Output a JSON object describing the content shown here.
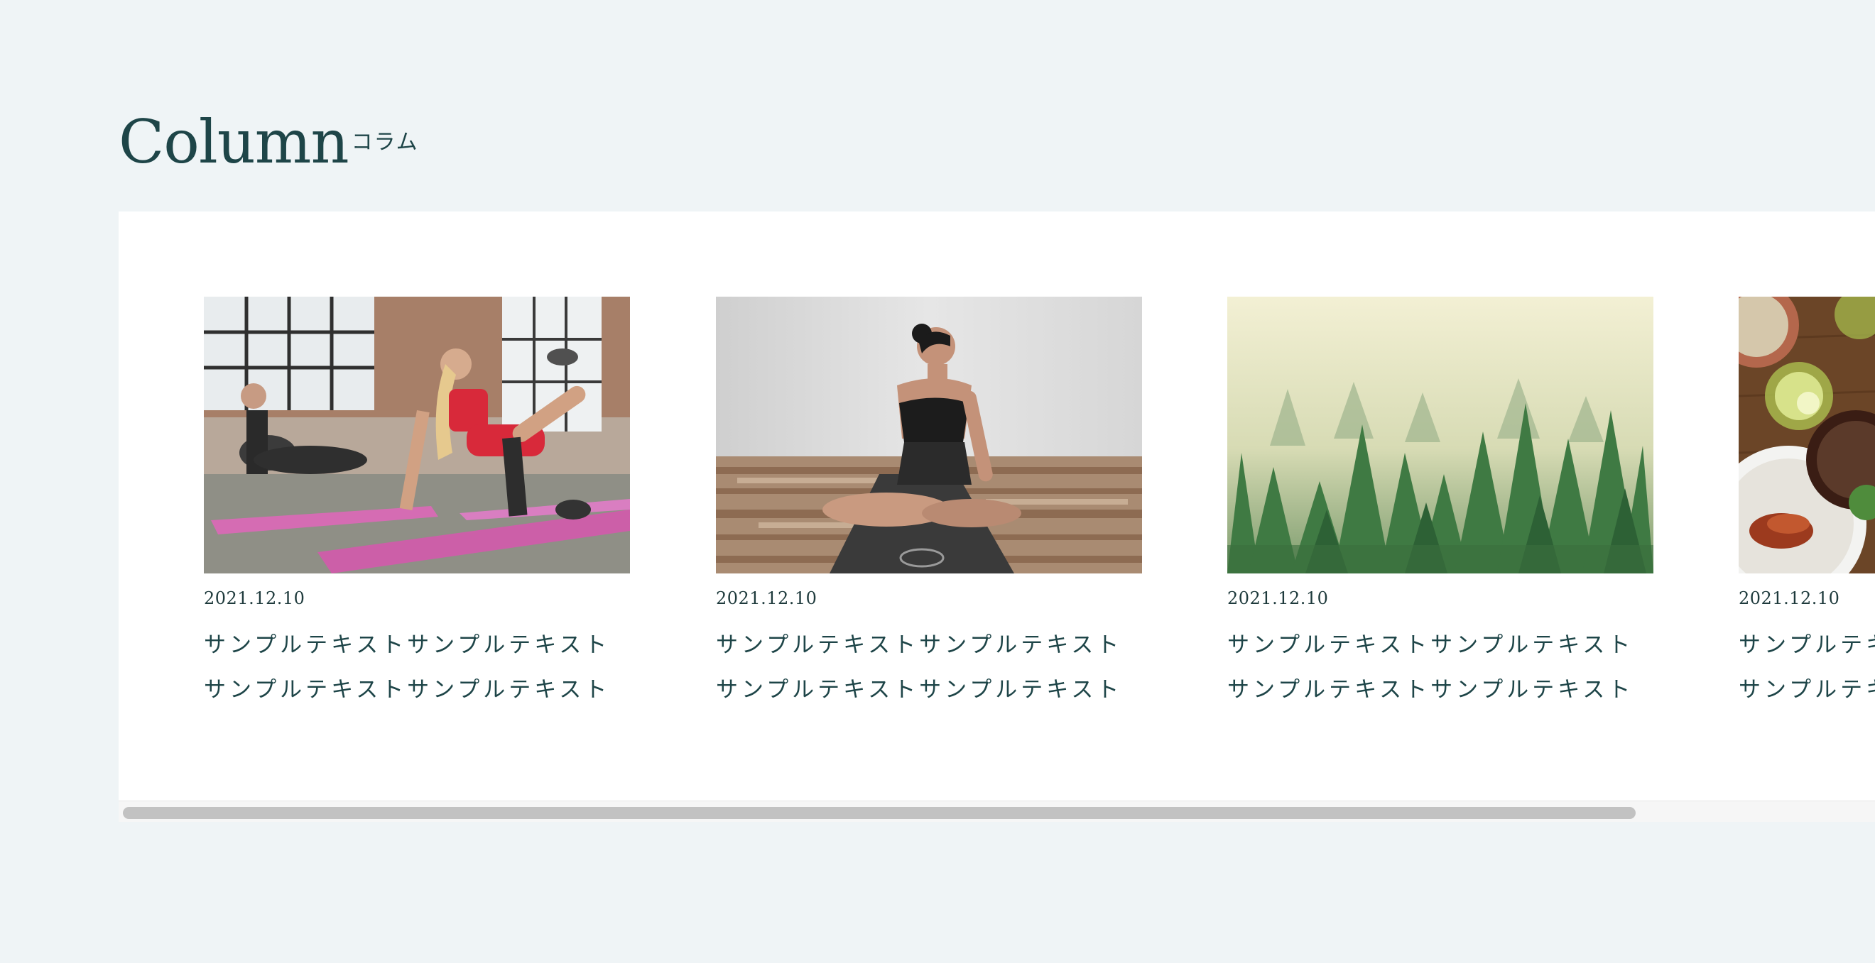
{
  "section": {
    "heading_en": "Column",
    "heading_ja": "コラム"
  },
  "columns": [
    {
      "image": "women-workout-on-mats-photo",
      "date": "2021.12.10",
      "title": "サンプルテキストサンプルテキストサンプルテキストサンプルテキスト"
    },
    {
      "image": "woman-yoga-seated-twist-photo",
      "date": "2021.12.10",
      "title": "サンプルテキストサンプルテキストサンプルテキストサンプルテキスト"
    },
    {
      "image": "misty-forest-photo",
      "date": "2021.12.10",
      "title": "サンプルテキストサンプルテキストサンプルテキストサンプルテキスト"
    },
    {
      "image": "food-and-drinks-table-photo",
      "date": "2021.12.10",
      "title": "サンプルテキストサンプルテキストサンプルテキストサンプルテキスト"
    }
  ],
  "scrollbar": {
    "position": 0.0
  },
  "colors": {
    "page_bg": "#eff4f6",
    "heading": "#1e4548",
    "panel_bg": "#ffffff",
    "scrollbar_thumb": "#c2c2c2"
  }
}
